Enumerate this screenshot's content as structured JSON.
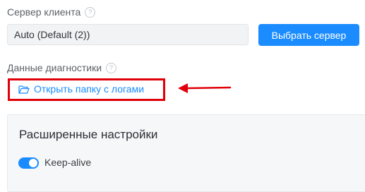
{
  "client_server": {
    "label": "Сервер клиента",
    "help_icon": "?",
    "select_value": "Auto (Default (2))",
    "button_label": "Выбрать сервер"
  },
  "diagnostics": {
    "label": "Данные диагностики",
    "help_icon": "?",
    "link_label": "Открыть папку с логами",
    "link_icon": "folder-open-icon"
  },
  "advanced": {
    "title": "Расширенные настройки",
    "keepalive_label": "Keep-alive",
    "keepalive_enabled": true
  },
  "colors": {
    "accent": "#1a8cff",
    "annotation": "#e0000a"
  }
}
